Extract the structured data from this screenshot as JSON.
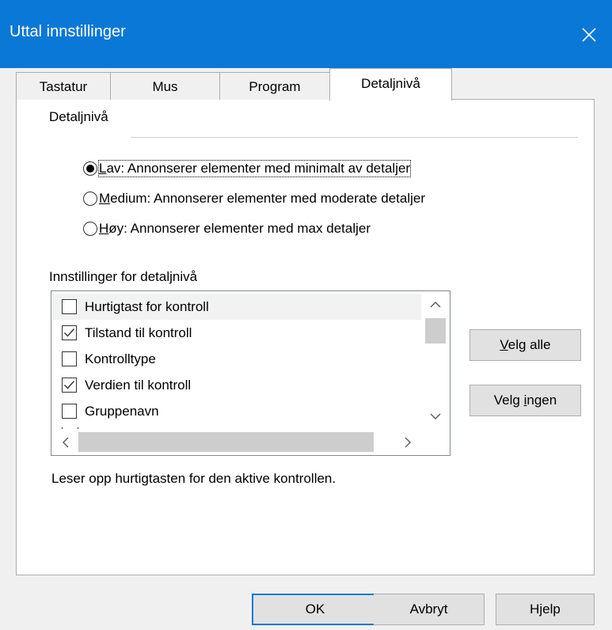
{
  "window": {
    "title": "Uttal innstillinger",
    "accent_color": "#0a78d7"
  },
  "tabs": [
    {
      "label": "Tastatur",
      "active": false
    },
    {
      "label": "Mus",
      "active": false
    },
    {
      "label": "Program",
      "active": false
    },
    {
      "label": "Detaljnivå",
      "active": true
    }
  ],
  "detail_group": {
    "label": "Detaljnivå",
    "options": [
      {
        "mnemonic": "L",
        "rest": "av: Annonserer elementer med minimalt av detaljer",
        "selected": true
      },
      {
        "mnemonic": "M",
        "rest": "edium: Annonserer elementer med moderate detaljer",
        "selected": false
      },
      {
        "mnemonic": "H",
        "rest": "øy: Annonserer elementer med max detaljer",
        "selected": false
      }
    ]
  },
  "settings": {
    "label": "Innstillinger for detaljnivå",
    "items": [
      {
        "label": "Hurtigtast for kontroll",
        "checked": false
      },
      {
        "label": "Tilstand til kontroll",
        "checked": true
      },
      {
        "label": "Kontrolltype",
        "checked": false
      },
      {
        "label": "Verdien til kontroll",
        "checked": true
      },
      {
        "label": "Gruppenavn",
        "checked": false
      }
    ],
    "select_all": {
      "mnemonic": "V",
      "rest": "elg alle"
    },
    "select_none": {
      "prefix": "Velg ",
      "mnemonic": "i",
      "rest": "ngen"
    }
  },
  "description": "Leser opp hurtigtasten for den aktive kontrollen.",
  "footer": {
    "ok": "OK",
    "cancel": "Avbryt",
    "help": "Hjelp"
  },
  "icons": {
    "close": "close-icon",
    "radio_selected": "radio-selected-icon",
    "checkmark": "checkmark-icon"
  }
}
